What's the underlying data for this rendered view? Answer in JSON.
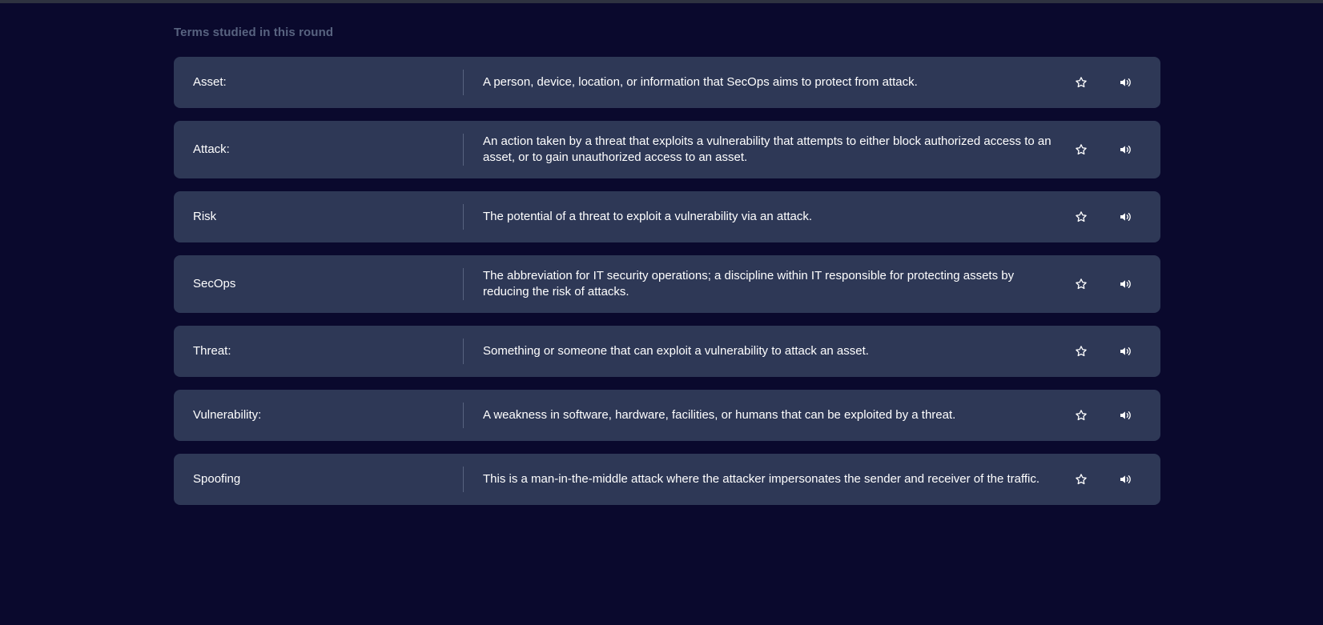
{
  "section_title": "Terms studied in this round",
  "terms": [
    {
      "term": "Asset:",
      "definition": "A person, device, location, or information that SecOps aims to protect from attack."
    },
    {
      "term": "Attack:",
      "definition": "An action taken by a threat that exploits a vulnerability that attempts to either block authorized access to an asset, or to gain unauthorized access to an asset."
    },
    {
      "term": "Risk",
      "definition": "The potential of a threat to exploit a vulnerability via an attack."
    },
    {
      "term": "SecOps",
      "definition": "The abbreviation for IT security operations; a discipline within IT responsible for protecting assets by reducing the risk of attacks."
    },
    {
      "term": "Threat:",
      "definition": "Something or someone that can exploit a vulnerability to attack an asset."
    },
    {
      "term": "Vulnerability:",
      "definition": "A weakness in software, hardware, facilities, or humans that can be exploited by a threat."
    },
    {
      "term": "Spoofing",
      "definition": "This is a man-in-the-middle attack where the attacker impersonates the sender and receiver of the traffic."
    }
  ],
  "icons": {
    "star": "star-icon",
    "audio": "speaker-icon"
  },
  "colors": {
    "background": "#0a092d",
    "card": "#2e3856",
    "muted_text": "#586380",
    "text": "#ffffff"
  }
}
